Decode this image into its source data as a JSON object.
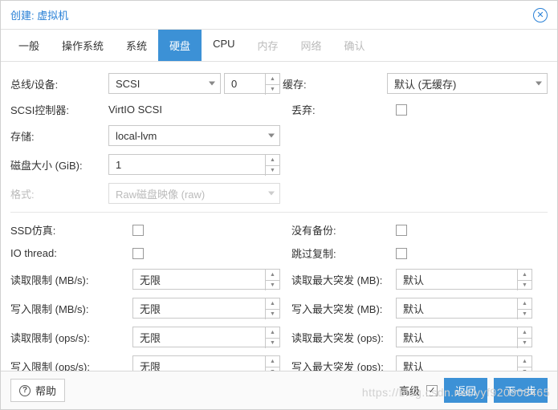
{
  "header": {
    "title": "创建: 虚拟机"
  },
  "tabs": {
    "general": "一般",
    "os": "操作系统",
    "system": "系统",
    "disk": "硬盘",
    "cpu": "CPU",
    "memory": "内存",
    "network": "网络",
    "confirm": "确认"
  },
  "labels": {
    "bus_device": "总线/设备:",
    "scsi_controller": "SCSI控制器:",
    "storage": "存储:",
    "disk_size": "磁盘大小 (GiB):",
    "format": "格式:",
    "cache": "缓存:",
    "discard": "丢弃:",
    "ssd_emulation": "SSD仿真:",
    "no_backup": "没有备份:",
    "io_thread": "IO thread:",
    "skip_replication": "跳过复制:",
    "read_limit_mb": "读取限制 (MB/s):",
    "read_max_burst_mb": "读取最大突发 (MB):",
    "write_limit_mb": "写入限制 (MB/s):",
    "write_max_burst_mb": "写入最大突发 (MB):",
    "read_limit_ops": "读取限制 (ops/s):",
    "read_max_burst_ops": "读取最大突发 (ops):",
    "write_limit_ops": "写入限制 (ops/s):",
    "write_max_burst_ops": "写入最大突发 (ops):"
  },
  "values": {
    "bus": "SCSI",
    "device_index": "0",
    "scsi_controller": "VirtIO SCSI",
    "storage": "local-lvm",
    "disk_size": "1",
    "format": "Raw磁盘映像 (raw)",
    "cache": "默认 (无缓存)",
    "unlimited": "无限",
    "default": "默认"
  },
  "footer": {
    "help": "帮助",
    "advanced": "高级",
    "back": "返回",
    "next": "下一步"
  },
  "watermark": "https://blog.csdn.net/yyf920908465"
}
